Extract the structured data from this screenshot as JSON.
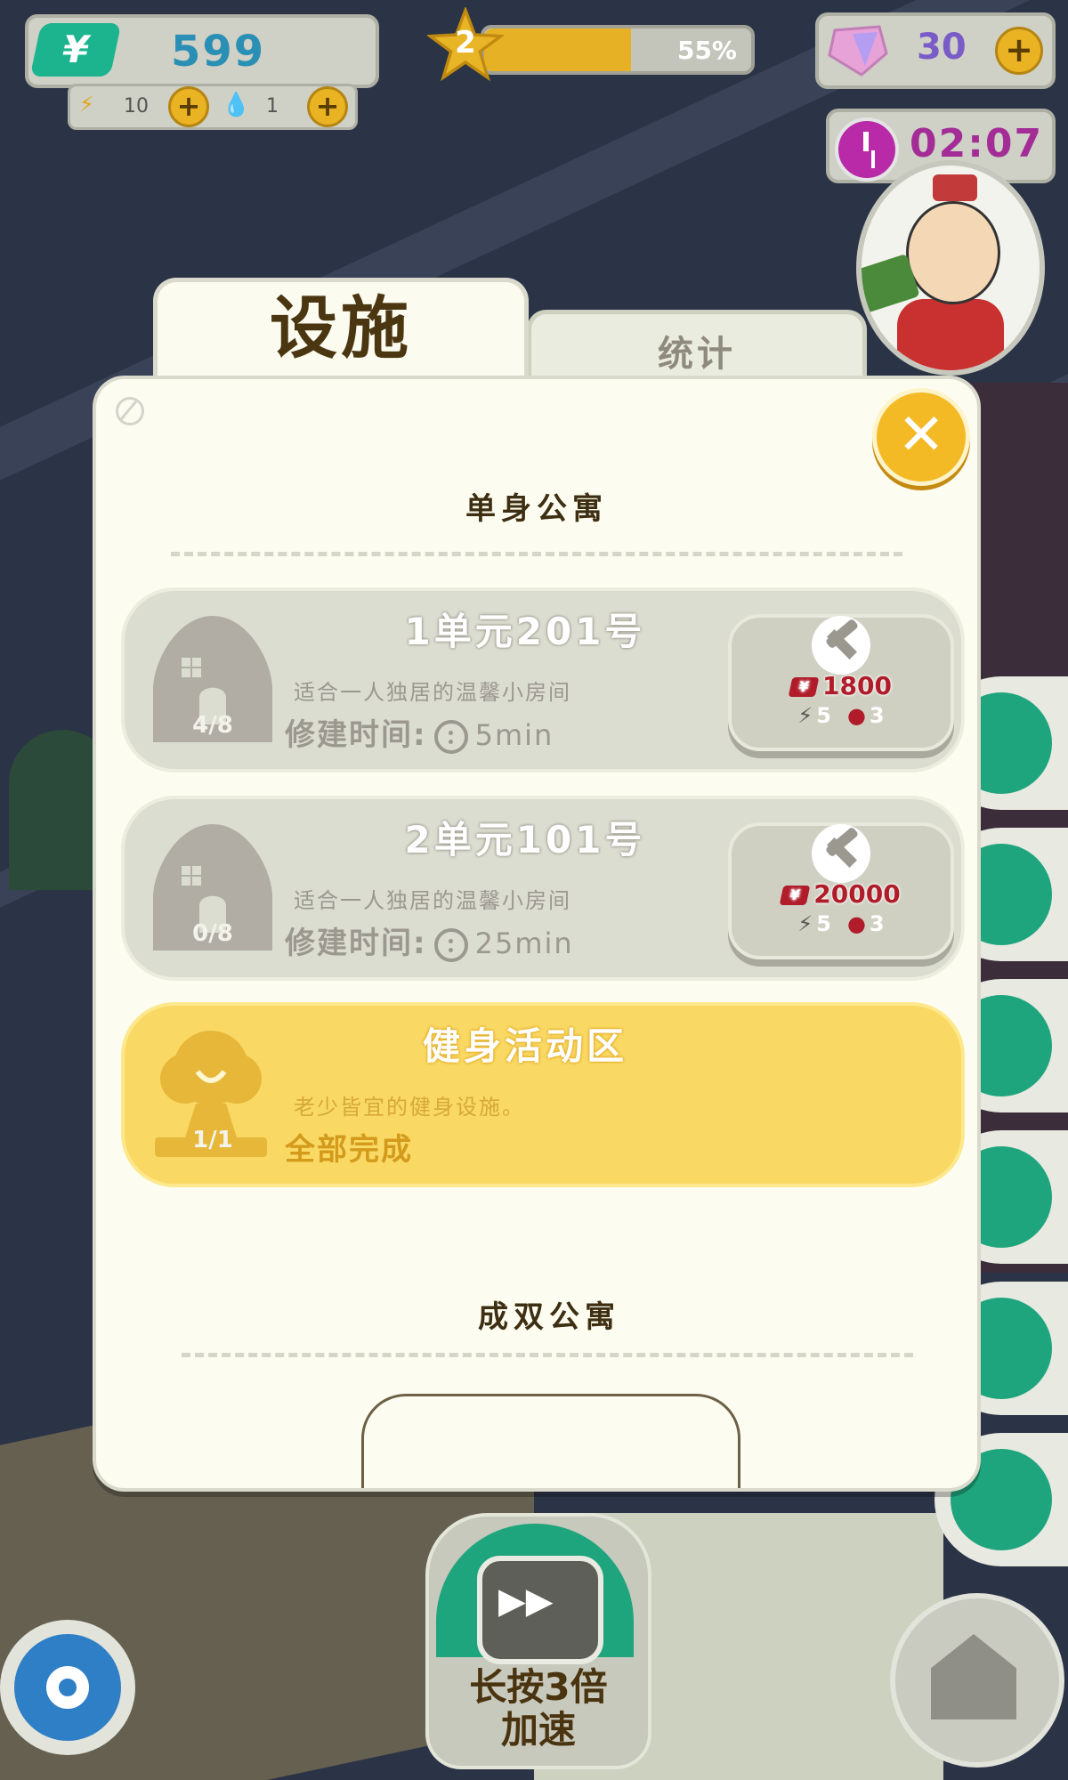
{
  "hud": {
    "money": "599",
    "money_icon": "yen-icon",
    "energy": "10",
    "water": "1",
    "level": "2",
    "level_progress_label": "55%",
    "level_progress": 0.55,
    "gems": "30",
    "timer": "02:07"
  },
  "dialog": {
    "tab_active": "设施",
    "tab_inactive": "统计",
    "close_icon": "close-icon",
    "section1_title": "单身公寓",
    "section2_title": "成双公寓",
    "items": [
      {
        "title": "1单元201号",
        "count": "4/8",
        "desc": "适合一人独居的温馨小房间",
        "build_label": "修建时间:",
        "build_time": "5min",
        "cost_money": "1800",
        "cost_energy": "5",
        "cost_water": "3",
        "state": "available"
      },
      {
        "title": "2单元101号",
        "count": "0/8",
        "desc": "适合一人独居的温馨小房间",
        "build_label": "修建时间:",
        "build_time": "25min",
        "cost_money": "20000",
        "cost_energy": "5",
        "cost_water": "3",
        "state": "available"
      },
      {
        "title": "健身活动区",
        "count": "1/1",
        "desc": "老少皆宜的健身设施。",
        "status": "全部完成",
        "state": "done"
      }
    ]
  },
  "bottom": {
    "speed_label_line1": "长按3倍",
    "speed_label_line2": "加速"
  },
  "colors": {
    "accent_yellow": "#f3ba26",
    "green": "#1fa57d",
    "panel_bg": "#fcfdf0",
    "done_card": "#f9d964",
    "cost_red": "#b01c2a"
  }
}
